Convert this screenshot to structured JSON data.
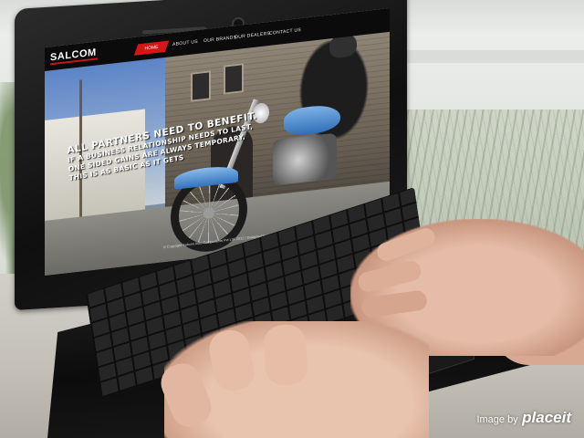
{
  "website": {
    "logo": "SALCOM",
    "nav": [
      "HOME",
      "ABOUT US",
      "OUR BRANDS",
      "OUR DEALERS",
      "CONTACT US"
    ],
    "slogan": {
      "headline": "ALL PARTNERS NEED TO BENEFIT.",
      "lines": [
        "IF A BUSINESS RELATIONSHIP NEEDS TO LAST,",
        "ONE SIDED GAINS ARE ALWAYS TEMPORARY.",
        "THIS IS AS BASIC AS IT GETS"
      ]
    },
    "footer": "© Copyright Salcom Auto Components Pvt Ltd. 2012 | Designed by"
  },
  "watermark": {
    "prefix": "Image by",
    "brand": "placeit"
  },
  "colors": {
    "accent": "#d41616",
    "nav_bg": "#0b0b0b",
    "motorcycle": "#2f6fb8"
  }
}
